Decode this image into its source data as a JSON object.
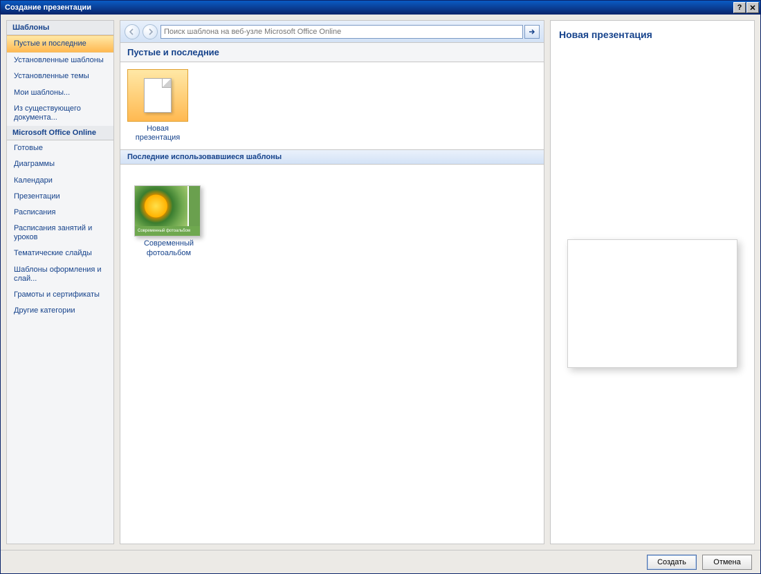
{
  "window": {
    "title": "Создание презентации"
  },
  "sidebar": {
    "header1": "Шаблоны",
    "items": [
      {
        "label": "Пустые и последние",
        "selected": true
      },
      {
        "label": "Установленные шаблоны"
      },
      {
        "label": "Установленные темы"
      },
      {
        "label": "Мои шаблоны..."
      },
      {
        "label": "Из существующего документа..."
      }
    ],
    "header2": "Microsoft Office Online",
    "items2": [
      {
        "label": "Готовые"
      },
      {
        "label": "Диаграммы"
      },
      {
        "label": "Календари"
      },
      {
        "label": "Презентации"
      },
      {
        "label": "Расписания"
      },
      {
        "label": "Расписания занятий и уроков"
      },
      {
        "label": "Тематические слайды"
      },
      {
        "label": "Шаблоны оформления и слай..."
      },
      {
        "label": "Грамоты и сертификаты"
      },
      {
        "label": "Другие категории"
      }
    ]
  },
  "toolbar": {
    "search_placeholder": "Поиск шаблона на веб-узле Microsoft Office Online"
  },
  "main": {
    "section_title": "Пустые и последние",
    "tile_new": "Новая презентация",
    "subsection_title": "Последние использовавшиеся шаблоны",
    "template_caption": "Современный фотоальбом",
    "template_label": "Современный фотоальбом"
  },
  "preview": {
    "title": "Новая презентация"
  },
  "footer": {
    "create": "Создать",
    "cancel": "Отмена"
  }
}
